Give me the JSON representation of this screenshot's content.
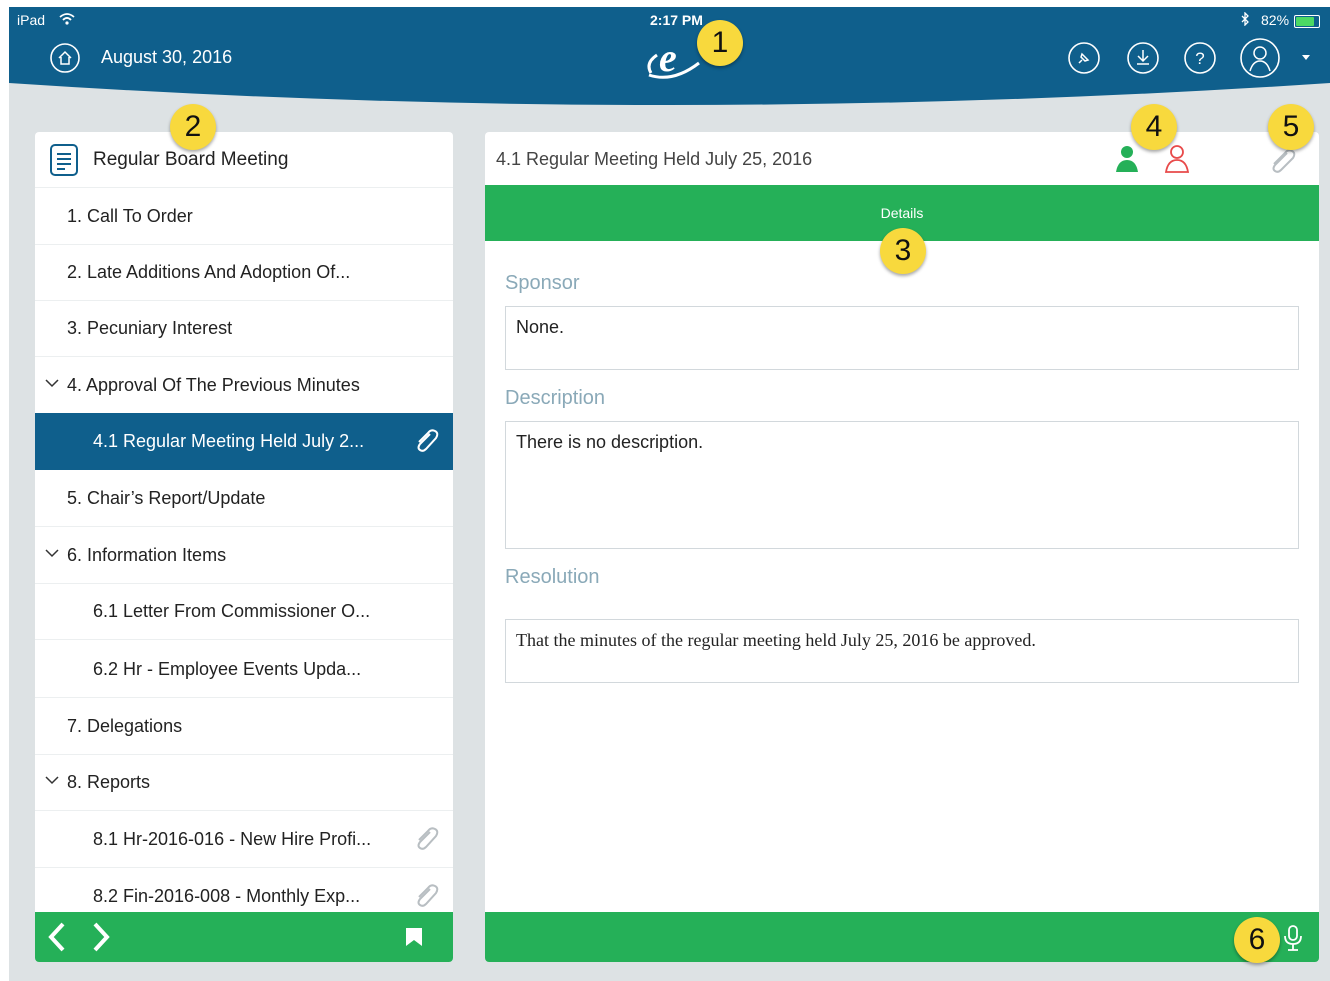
{
  "status_bar": {
    "carrier": "iPad",
    "time": "2:17 PM",
    "battery_percent": "82%",
    "battery_level": 0.82
  },
  "header": {
    "date": "August 30, 2016",
    "icons": [
      "home-icon",
      "pin-icon",
      "download-icon",
      "help-icon",
      "user-avatar-icon",
      "caret-down-icon"
    ],
    "background_color": "#0f5f8c"
  },
  "callouts": [
    "1",
    "2",
    "3",
    "4",
    "5",
    "6"
  ],
  "agenda": {
    "title": "Regular Board Meeting",
    "items": [
      {
        "label": "1. Call To Order"
      },
      {
        "label": "2. Late Additions And Adoption Of..."
      },
      {
        "label": "3. Pecuniary Interest"
      },
      {
        "label": "4. Approval Of The Previous Minutes"
      },
      {
        "label": "4.1 Regular Meeting Held July 2..."
      },
      {
        "label": "5. Chair’s Report/Update"
      },
      {
        "label": "6. Information Items"
      },
      {
        "label": "6.1 Letter From Commissioner O..."
      },
      {
        "label": "6.2 Hr - Employee Events Upda..."
      },
      {
        "label": "7. Delegations"
      },
      {
        "label": "8. Reports"
      },
      {
        "label": "8.1 Hr-2016-016 - New Hire Profi..."
      },
      {
        "label": "8.2 Fin-2016-008 - Monthly Exp..."
      }
    ],
    "selected_color": "#0f5f8c"
  },
  "detail": {
    "title": "4.1 Regular Meeting Held July 25, 2016",
    "tab_label": "Details",
    "sponsor_label": "Sponsor",
    "sponsor_value": "None.",
    "description_label": "Description",
    "description_value": "There is no description.",
    "resolution_label": "Resolution",
    "resolution_value": "That the minutes of the regular meeting held July 25, 2016 be approved.",
    "accent_color": "#25b058",
    "voted_for_color": "#25b058",
    "voted_against_color": "#e84a4a"
  }
}
